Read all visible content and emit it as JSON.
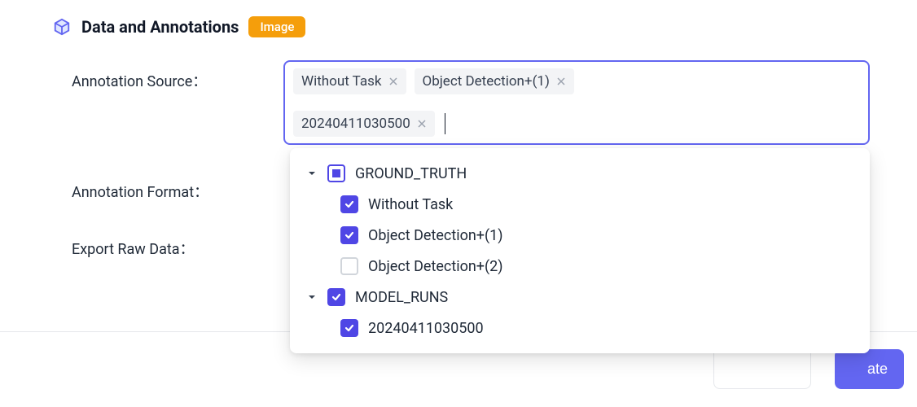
{
  "section": {
    "title": "Data and Annotations",
    "badge": "Image"
  },
  "form": {
    "annotation_source_label": "Annotation Source：",
    "annotation_format_label": "Annotation Format：",
    "export_raw_data_label": "Export Raw Data："
  },
  "selected_tags": [
    {
      "label": "Without Task"
    },
    {
      "label": "Object Detection+(1)"
    },
    {
      "label": "20240411030500"
    }
  ],
  "tree": {
    "groups": [
      {
        "label": "GROUND_TRUTH",
        "state": "indeterminate",
        "items": [
          {
            "label": "Without Task",
            "checked": true
          },
          {
            "label": "Object Detection+(1)",
            "checked": true
          },
          {
            "label": "Object Detection+(2)",
            "checked": false
          }
        ]
      },
      {
        "label": "MODEL_RUNS",
        "state": "checked",
        "items": [
          {
            "label": "20240411030500",
            "checked": true
          }
        ]
      }
    ]
  },
  "footer": {
    "primary_button_fragment": "ate"
  },
  "colors": {
    "accent": "#4f46e5",
    "badge": "#f59e0b"
  }
}
